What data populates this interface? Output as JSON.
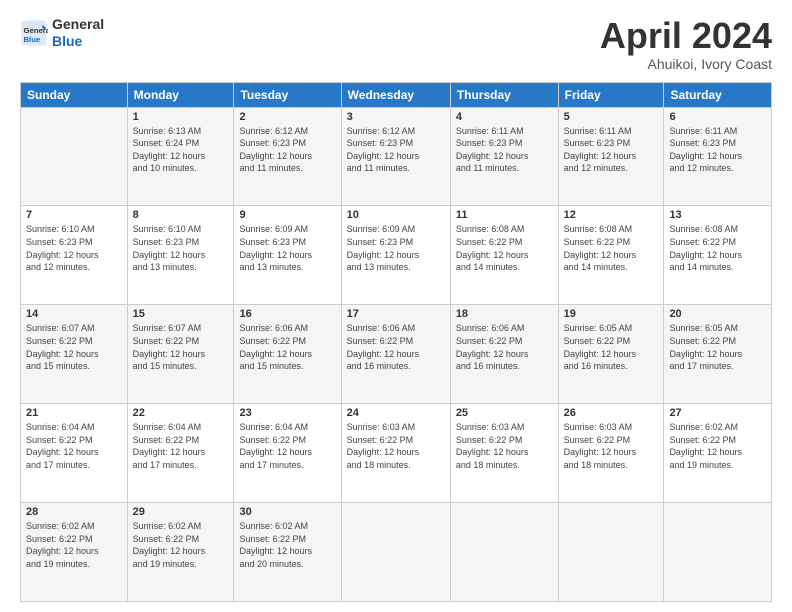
{
  "logo": {
    "line1": "General",
    "line2": "Blue"
  },
  "header": {
    "title": "April 2024",
    "subtitle": "Ahuikoi, Ivory Coast"
  },
  "weekdays": [
    "Sunday",
    "Monday",
    "Tuesday",
    "Wednesday",
    "Thursday",
    "Friday",
    "Saturday"
  ],
  "weeks": [
    [
      {
        "day": "",
        "info": ""
      },
      {
        "day": "1",
        "info": "Sunrise: 6:13 AM\nSunset: 6:24 PM\nDaylight: 12 hours\nand 10 minutes."
      },
      {
        "day": "2",
        "info": "Sunrise: 6:12 AM\nSunset: 6:23 PM\nDaylight: 12 hours\nand 11 minutes."
      },
      {
        "day": "3",
        "info": "Sunrise: 6:12 AM\nSunset: 6:23 PM\nDaylight: 12 hours\nand 11 minutes."
      },
      {
        "day": "4",
        "info": "Sunrise: 6:11 AM\nSunset: 6:23 PM\nDaylight: 12 hours\nand 11 minutes."
      },
      {
        "day": "5",
        "info": "Sunrise: 6:11 AM\nSunset: 6:23 PM\nDaylight: 12 hours\nand 12 minutes."
      },
      {
        "day": "6",
        "info": "Sunrise: 6:11 AM\nSunset: 6:23 PM\nDaylight: 12 hours\nand 12 minutes."
      }
    ],
    [
      {
        "day": "7",
        "info": "Sunrise: 6:10 AM\nSunset: 6:23 PM\nDaylight: 12 hours\nand 12 minutes."
      },
      {
        "day": "8",
        "info": "Sunrise: 6:10 AM\nSunset: 6:23 PM\nDaylight: 12 hours\nand 13 minutes."
      },
      {
        "day": "9",
        "info": "Sunrise: 6:09 AM\nSunset: 6:23 PM\nDaylight: 12 hours\nand 13 minutes."
      },
      {
        "day": "10",
        "info": "Sunrise: 6:09 AM\nSunset: 6:23 PM\nDaylight: 12 hours\nand 13 minutes."
      },
      {
        "day": "11",
        "info": "Sunrise: 6:08 AM\nSunset: 6:22 PM\nDaylight: 12 hours\nand 14 minutes."
      },
      {
        "day": "12",
        "info": "Sunrise: 6:08 AM\nSunset: 6:22 PM\nDaylight: 12 hours\nand 14 minutes."
      },
      {
        "day": "13",
        "info": "Sunrise: 6:08 AM\nSunset: 6:22 PM\nDaylight: 12 hours\nand 14 minutes."
      }
    ],
    [
      {
        "day": "14",
        "info": "Sunrise: 6:07 AM\nSunset: 6:22 PM\nDaylight: 12 hours\nand 15 minutes."
      },
      {
        "day": "15",
        "info": "Sunrise: 6:07 AM\nSunset: 6:22 PM\nDaylight: 12 hours\nand 15 minutes."
      },
      {
        "day": "16",
        "info": "Sunrise: 6:06 AM\nSunset: 6:22 PM\nDaylight: 12 hours\nand 15 minutes."
      },
      {
        "day": "17",
        "info": "Sunrise: 6:06 AM\nSunset: 6:22 PM\nDaylight: 12 hours\nand 16 minutes."
      },
      {
        "day": "18",
        "info": "Sunrise: 6:06 AM\nSunset: 6:22 PM\nDaylight: 12 hours\nand 16 minutes."
      },
      {
        "day": "19",
        "info": "Sunrise: 6:05 AM\nSunset: 6:22 PM\nDaylight: 12 hours\nand 16 minutes."
      },
      {
        "day": "20",
        "info": "Sunrise: 6:05 AM\nSunset: 6:22 PM\nDaylight: 12 hours\nand 17 minutes."
      }
    ],
    [
      {
        "day": "21",
        "info": "Sunrise: 6:04 AM\nSunset: 6:22 PM\nDaylight: 12 hours\nand 17 minutes."
      },
      {
        "day": "22",
        "info": "Sunrise: 6:04 AM\nSunset: 6:22 PM\nDaylight: 12 hours\nand 17 minutes."
      },
      {
        "day": "23",
        "info": "Sunrise: 6:04 AM\nSunset: 6:22 PM\nDaylight: 12 hours\nand 17 minutes."
      },
      {
        "day": "24",
        "info": "Sunrise: 6:03 AM\nSunset: 6:22 PM\nDaylight: 12 hours\nand 18 minutes."
      },
      {
        "day": "25",
        "info": "Sunrise: 6:03 AM\nSunset: 6:22 PM\nDaylight: 12 hours\nand 18 minutes."
      },
      {
        "day": "26",
        "info": "Sunrise: 6:03 AM\nSunset: 6:22 PM\nDaylight: 12 hours\nand 18 minutes."
      },
      {
        "day": "27",
        "info": "Sunrise: 6:02 AM\nSunset: 6:22 PM\nDaylight: 12 hours\nand 19 minutes."
      }
    ],
    [
      {
        "day": "28",
        "info": "Sunrise: 6:02 AM\nSunset: 6:22 PM\nDaylight: 12 hours\nand 19 minutes."
      },
      {
        "day": "29",
        "info": "Sunrise: 6:02 AM\nSunset: 6:22 PM\nDaylight: 12 hours\nand 19 minutes."
      },
      {
        "day": "30",
        "info": "Sunrise: 6:02 AM\nSunset: 6:22 PM\nDaylight: 12 hours\nand 20 minutes."
      },
      {
        "day": "",
        "info": ""
      },
      {
        "day": "",
        "info": ""
      },
      {
        "day": "",
        "info": ""
      },
      {
        "day": "",
        "info": ""
      }
    ]
  ]
}
